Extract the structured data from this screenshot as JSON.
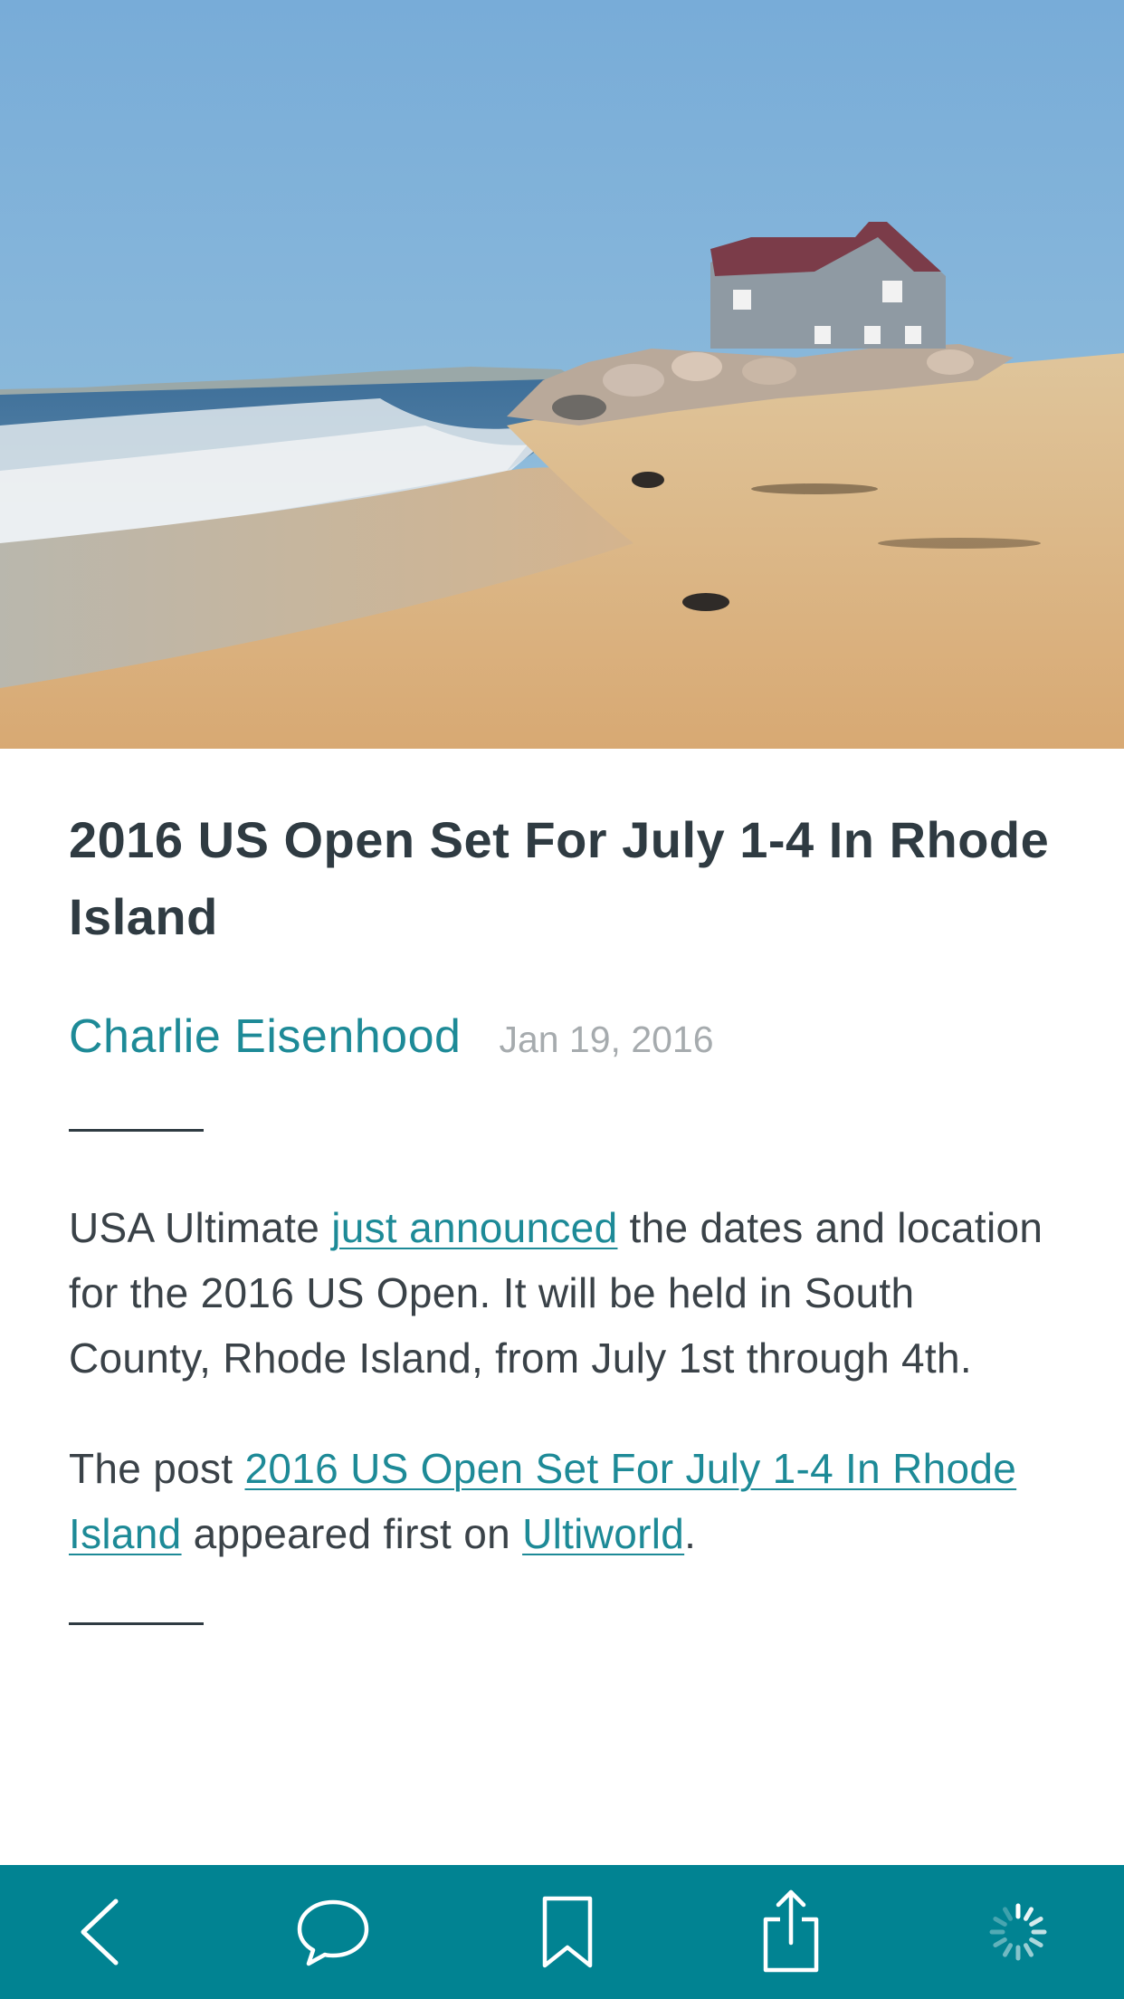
{
  "hero": {
    "image": "beach-house-photo",
    "colors": {
      "sky": "#7fb0d6",
      "sea": "#4c7fa6",
      "sand": "#d9b584"
    }
  },
  "article": {
    "title": "2016 US Open Set For July 1-4 In Rhode Island",
    "author": "Charlie Eisenhood",
    "date": "Jan 19, 2016",
    "paragraph1": {
      "before": "USA Ultimate ",
      "link": "just announced",
      "after": " the dates and location for the 2016 US Open. It will be held in South County, Rhode Island, from July 1st through 4th."
    },
    "paragraph2": {
      "before": "The post ",
      "link1": "2016 US Open Set For July 1-4 In Rhode Island",
      "middle": " appeared first on ",
      "link2": "Ultiworld",
      "after": "."
    }
  },
  "toolbar": {
    "background": "#018392",
    "buttons": [
      "back-icon",
      "comment-icon",
      "bookmark-icon",
      "share-icon",
      "loading-spinner-icon"
    ]
  },
  "colors": {
    "accent": "#1d8a97",
    "title": "#2f3b42",
    "text": "#3a4248",
    "muted": "#a6abae"
  }
}
